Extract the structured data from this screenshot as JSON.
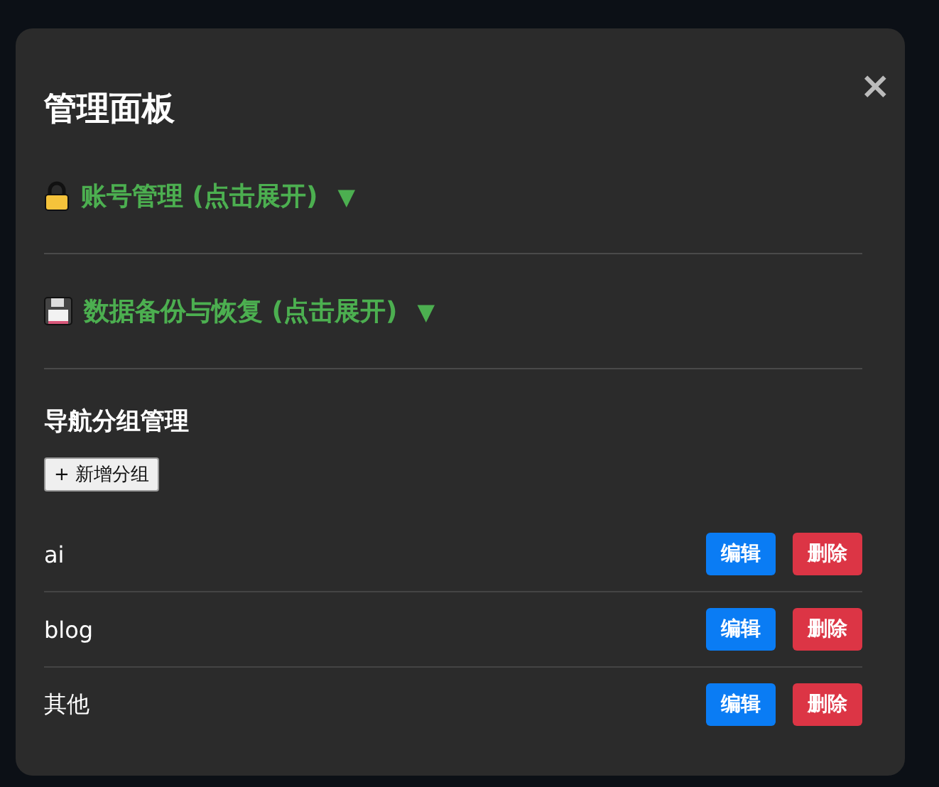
{
  "dialog": {
    "title": "管理面板",
    "close": "×"
  },
  "sections": [
    {
      "label": "账号管理 (点击展开)",
      "arrow": "▼"
    },
    {
      "label": "数据备份与恢复 (点击展开)",
      "arrow": "▼"
    }
  ],
  "groups": {
    "heading": "导航分组管理",
    "add_button": "+ 新增分组",
    "rows": [
      {
        "name": "ai",
        "edit": "编辑",
        "delete": "删除"
      },
      {
        "name": "blog",
        "edit": "编辑",
        "delete": "删除"
      },
      {
        "name": "其他",
        "edit": "编辑",
        "delete": "删除"
      }
    ]
  }
}
